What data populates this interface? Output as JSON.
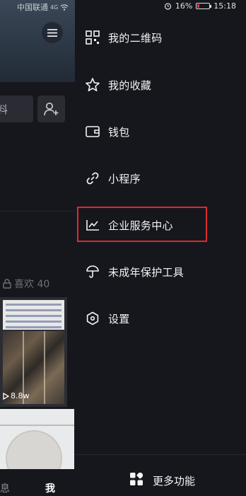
{
  "status_bar": {
    "carrier": "中国联通",
    "signal": "4G",
    "battery_percent": "16%",
    "time": "15:18"
  },
  "background_page": {
    "edit_button_partial": "料",
    "likes_label": "喜欢 40",
    "video_views": "8.8w",
    "nav_messages_partial": "息",
    "nav_me": "我"
  },
  "drawer": {
    "items": [
      {
        "label": "我的二维码",
        "icon": "qr-code-icon"
      },
      {
        "label": "我的收藏",
        "icon": "star-icon"
      },
      {
        "label": "钱包",
        "icon": "wallet-icon"
      },
      {
        "label": "小程序",
        "icon": "link-icon"
      },
      {
        "label": "企业服务中心",
        "icon": "trend-chart-icon"
      },
      {
        "label": "未成年保护工具",
        "icon": "umbrella-icon"
      },
      {
        "label": "设置",
        "icon": "hexagon-settings-icon"
      }
    ],
    "more_features": "更多功能",
    "highlight_color": "#e02a2a"
  },
  "colors": {
    "drawer_bg": "#16171d",
    "text": "#f4f4f6"
  }
}
